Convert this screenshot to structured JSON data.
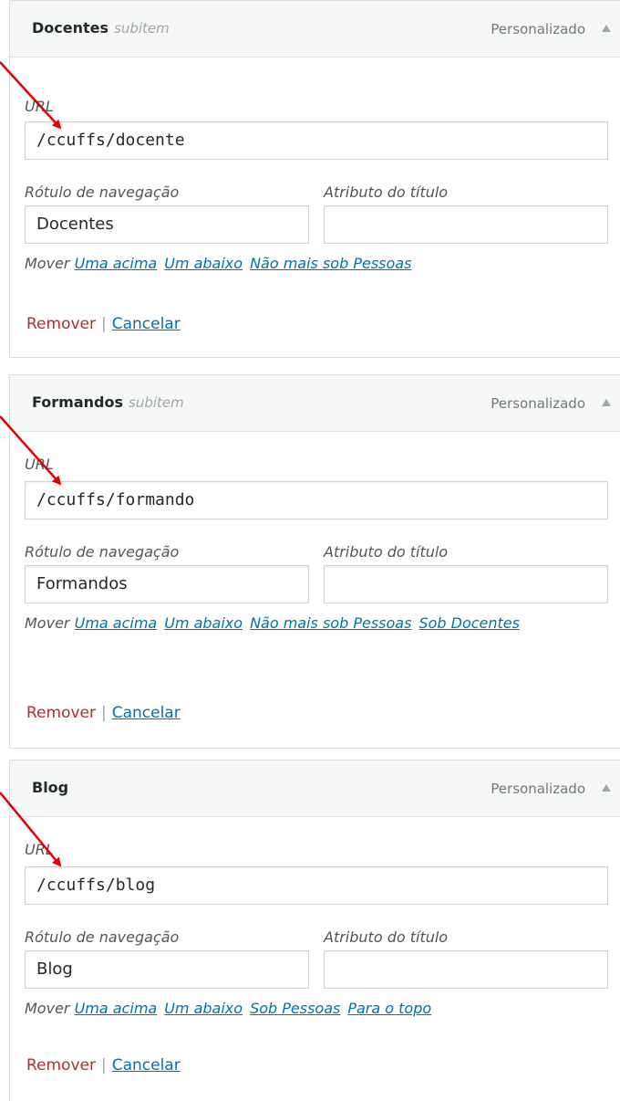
{
  "common": {
    "url_label": "URL",
    "nav_label": "Rótulo de navegação",
    "title_attr_label": "Atributo do título",
    "move_label": "Mover",
    "remove_label": "Remover",
    "separator": "|",
    "cancel_label": "Cancelar",
    "item_type": "Personalizado"
  },
  "items": [
    {
      "title": "Docentes",
      "subtitle": "subitem",
      "url": "/ccuffs/docente",
      "nav_label_value": "Docentes",
      "title_attr_value": "",
      "move_links": [
        "Uma acima",
        "Um abaixo",
        "Não mais sob Pessoas"
      ]
    },
    {
      "title": "Formandos",
      "subtitle": "subitem",
      "url": "/ccuffs/formando",
      "nav_label_value": "Formandos",
      "title_attr_value": "",
      "move_links": [
        "Uma acima",
        "Um abaixo",
        "Não mais sob Pessoas",
        "Sob Docentes"
      ]
    },
    {
      "title": "Blog",
      "subtitle": "",
      "url": "/ccuffs/blog",
      "nav_label_value": "Blog",
      "title_attr_value": "",
      "move_links": [
        "Uma acima",
        "Um abaixo",
        "Sob Pessoas",
        "Para o topo"
      ]
    }
  ],
  "annotation_color": "#e00000",
  "colors": {
    "link": "#0073aa",
    "remove": "#b32d2e"
  }
}
